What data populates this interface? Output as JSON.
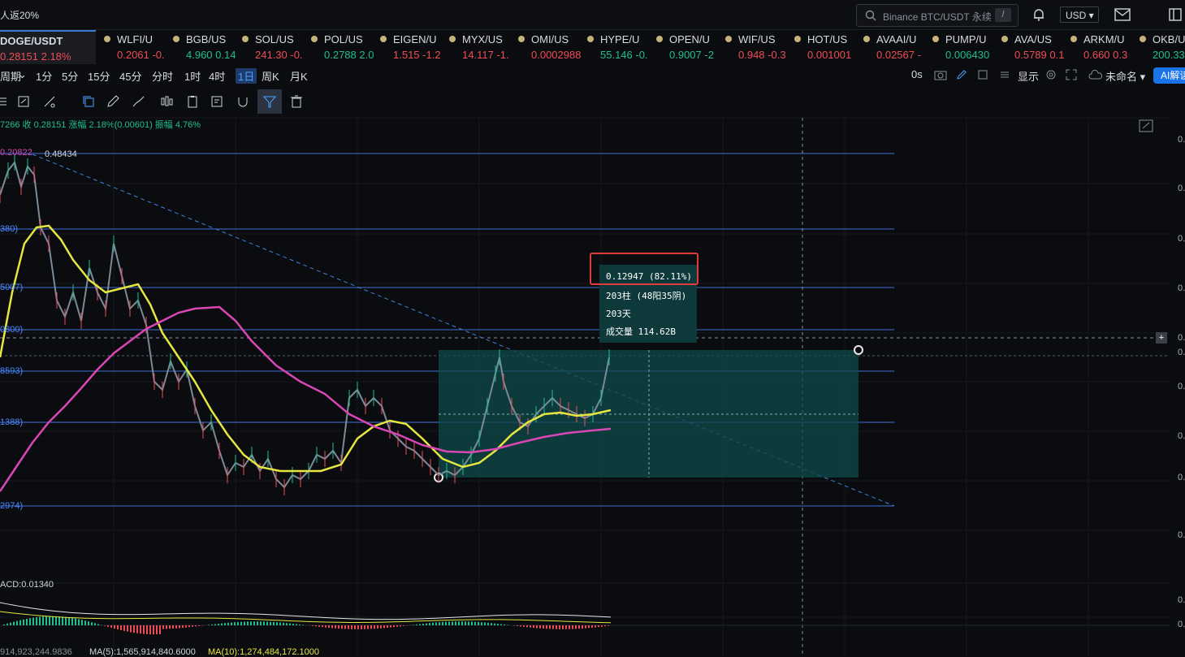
{
  "header": {
    "promo": "人返20%",
    "search_placeholder": "Binance BTC/USDT 永续",
    "search_key": "/",
    "currency": "USD"
  },
  "tickers": [
    {
      "name": "DOGE/USDT",
      "price": "0.28151 2.18%",
      "dir": "dn"
    },
    {
      "name": "WLFI/U",
      "price": "0.2061 -0.",
      "dir": "dn"
    },
    {
      "name": "BGB/US",
      "price": "4.960 0.14",
      "dir": "up"
    },
    {
      "name": "SOL/US",
      "price": "241.30 -0.",
      "dir": "dn"
    },
    {
      "name": "POL/US",
      "price": "0.2788 2.0",
      "dir": "up"
    },
    {
      "name": "EIGEN/U",
      "price": "1.515 -1.2",
      "dir": "dn"
    },
    {
      "name": "MYX/US",
      "price": "14.117 -1.",
      "dir": "dn"
    },
    {
      "name": "OMI/US",
      "price": "0.0002988",
      "dir": "dn"
    },
    {
      "name": "HYPE/U",
      "price": "55.146 -0.",
      "dir": "up"
    },
    {
      "name": "OPEN/U",
      "price": "0.9007 -2",
      "dir": "up"
    },
    {
      "name": "WIF/US",
      "price": "0.948 -0.3",
      "dir": "dn"
    },
    {
      "name": "HOT/US",
      "price": "0.001001",
      "dir": "dn"
    },
    {
      "name": "AVAAI/U",
      "price": "0.02567 -",
      "dir": "dn"
    },
    {
      "name": "PUMP/U",
      "price": "0.006430",
      "dir": "up"
    },
    {
      "name": "AVA/US",
      "price": "0.5789 0.1",
      "dir": "dn"
    },
    {
      "name": "ARKM/U",
      "price": "0.660 0.3",
      "dir": "dn"
    },
    {
      "name": "OKB/US",
      "price": "200.33 0",
      "dir": "up"
    }
  ],
  "intervals": [
    "周期",
    "1分",
    "5分",
    "15分",
    "45分",
    "分时",
    "1时",
    "4时",
    "1日",
    "周K",
    "月K"
  ],
  "active_interval": "1日",
  "right_controls": {
    "timer": "0s",
    "display": "显示",
    "layout_name": "未命名",
    "ai": "AI解读"
  },
  "stats_line": "7266 收 0.28151 涨幅 2.18%(0.00601) 振幅 4.76%",
  "chart_labels": {
    "ma_legend": "0.20822",
    "top_level": "0.48434",
    "levels_left": [
      "380)",
      "5007)",
      "0800)",
      "8593)",
      "1388)",
      "2974)"
    ],
    "macd": "ACD:0.01340",
    "vol_ma": "914,923,244.9836",
    "ma5": "MA(5):1,565,914,840.6000",
    "ma10": "MA(10):1,274,484,172.1000"
  },
  "measurement": {
    "change": "0.12947 (82.11%)",
    "bars": "203柱 (48阳35阴)",
    "days": "203天",
    "volume": "成交量 114.62B"
  },
  "axis_ticks": [
    "0.",
    "0.",
    "0.",
    "0.",
    "0.",
    "0.",
    "0.",
    "0.",
    "0.",
    "0.",
    "0.",
    "0."
  ],
  "colors": {
    "up": "#1fbf8f",
    "down": "#ef4d56",
    "fib": "#3f6fd8",
    "ma_yellow": "#e6e640",
    "ma_magenta": "#d946b5"
  }
}
